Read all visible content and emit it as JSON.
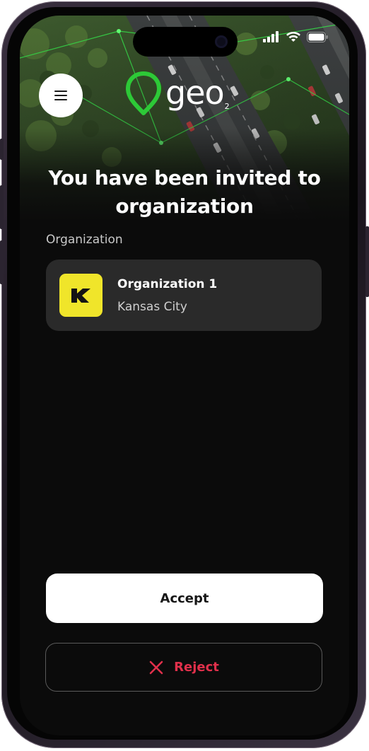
{
  "app": {
    "logo_text": "geo",
    "logo_subscript": "2",
    "brand_color": "#2dc937"
  },
  "header": {
    "title": "You have been invited to organization",
    "menu_icon": "hamburger-menu-icon"
  },
  "status_bar": {
    "icons": [
      "cellular-signal-icon",
      "wifi-icon",
      "battery-icon"
    ]
  },
  "organization_section": {
    "label": "Organization",
    "card": {
      "name": "Organization 1",
      "city": "Kansas City",
      "logo_icon": "k-letter-logo-icon",
      "logo_color": "#f0e52a"
    }
  },
  "actions": {
    "accept_label": "Accept",
    "reject_label": "Reject",
    "reject_icon": "close-x-icon",
    "reject_color": "#e0304b"
  }
}
